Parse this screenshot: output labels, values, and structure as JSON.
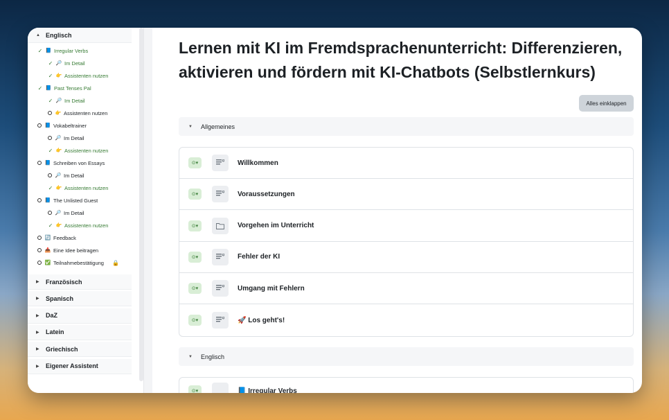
{
  "sidebar": {
    "englisch": {
      "label": "Englisch",
      "items": [
        {
          "level": 1,
          "done": true,
          "emoji": "📘",
          "label": "Irregular Verbs"
        },
        {
          "level": 2,
          "done": true,
          "emoji": "🔎",
          "label": "Im Detail"
        },
        {
          "level": 2,
          "done": true,
          "emoji": "👉",
          "label": "Assistenten nutzen"
        },
        {
          "level": 1,
          "done": true,
          "emoji": "📘",
          "label": "Past Tenses Pal"
        },
        {
          "level": 2,
          "done": true,
          "emoji": "🔎",
          "label": "Im Detail"
        },
        {
          "level": 2,
          "done": false,
          "emoji": "👉",
          "label": "Assistenten nutzen"
        },
        {
          "level": 1,
          "done": false,
          "emoji": "📘",
          "label": "Vokabeltrainer"
        },
        {
          "level": 2,
          "done": false,
          "emoji": "🔎",
          "label": "Im Detail"
        },
        {
          "level": 2,
          "done": true,
          "emoji": "👉",
          "label": "Assistenten nutzen"
        },
        {
          "level": 1,
          "done": false,
          "emoji": "📘",
          "label": "Schreiben von Essays"
        },
        {
          "level": 2,
          "done": false,
          "emoji": "🔎",
          "label": "Im Detail"
        },
        {
          "level": 2,
          "done": true,
          "emoji": "👉",
          "label": "Assistenten nutzen"
        },
        {
          "level": 1,
          "done": false,
          "emoji": "📘",
          "label": "The Unlisted Guest"
        },
        {
          "level": 2,
          "done": false,
          "emoji": "🔎",
          "label": "Im Detail"
        },
        {
          "level": 2,
          "done": true,
          "emoji": "👉",
          "label": "Assistenten nutzen"
        },
        {
          "level": 1,
          "done": false,
          "emoji": "🔄",
          "label": "Feedback"
        },
        {
          "level": 1,
          "done": false,
          "emoji": "📥",
          "label": "Eine Idee beitragen"
        },
        {
          "level": 1,
          "done": false,
          "emoji": "✅",
          "label": "Teilnahmebestätigung",
          "locked": true
        }
      ]
    },
    "sections": [
      "Französisch",
      "Spanisch",
      "DaZ",
      "Latein",
      "Griechisch",
      "Eigener Assistent"
    ]
  },
  "main": {
    "title": "Lernen mit KI im Fremdsprachenunterricht: Differenzieren, aktivieren und fördern mit KI-Chatbots (Selbstlernkurs)",
    "collapse_label": "Alles einklappen",
    "section1": "Allgemeines",
    "section2": "Englisch",
    "activities": [
      {
        "icon": "page",
        "label": "Willkommen"
      },
      {
        "icon": "page",
        "label": "Voraussetzungen"
      },
      {
        "icon": "folder",
        "label": "Vorgehen im Unterricht"
      },
      {
        "icon": "page",
        "label": "Fehler der KI"
      },
      {
        "icon": "page",
        "label": "Umgang mit Fehlern"
      },
      {
        "icon": "page",
        "label": "🚀 Los geht's!"
      }
    ],
    "next_activity": "📘 Irregular Verbs"
  }
}
